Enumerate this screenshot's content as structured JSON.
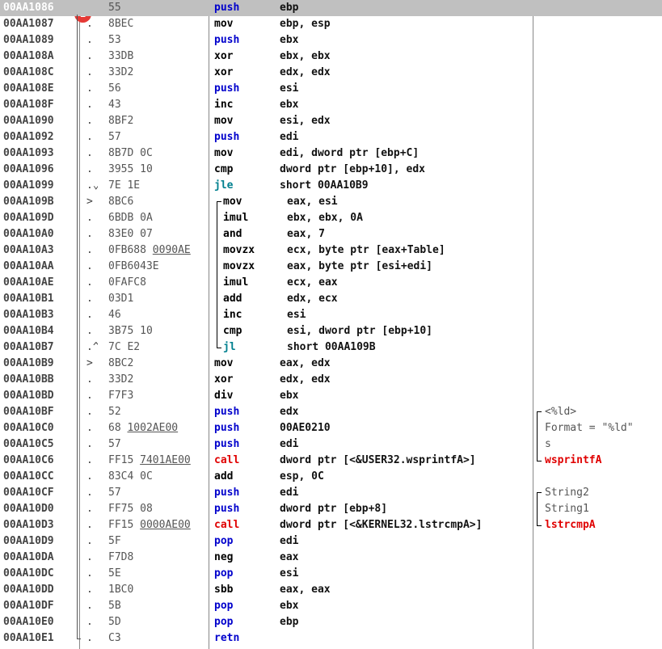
{
  "badge": "1",
  "selected_row": 0,
  "rows": [
    {
      "addr": "00AA1086",
      "mark": "",
      "hex": "55",
      "mnem": "push",
      "ops": "ebp",
      "cm": ""
    },
    {
      "addr": "00AA1087",
      "mark": ".",
      "hex": "8BEC",
      "mnem": "mov",
      "ops": "ebp, esp",
      "cm": ""
    },
    {
      "addr": "00AA1089",
      "mark": ".",
      "hex": "53",
      "mnem": "push",
      "ops": "ebx",
      "cm": ""
    },
    {
      "addr": "00AA108A",
      "mark": ".",
      "hex": "33DB",
      "mnem": "xor",
      "ops": "ebx, ebx",
      "cm": ""
    },
    {
      "addr": "00AA108C",
      "mark": ".",
      "hex": "33D2",
      "mnem": "xor",
      "ops": "edx, edx",
      "cm": ""
    },
    {
      "addr": "00AA108E",
      "mark": ".",
      "hex": "56",
      "mnem": "push",
      "ops": "esi",
      "cm": ""
    },
    {
      "addr": "00AA108F",
      "mark": ".",
      "hex": "43",
      "mnem": "inc",
      "ops": "ebx",
      "cm": ""
    },
    {
      "addr": "00AA1090",
      "mark": ".",
      "hex": "8BF2",
      "mnem": "mov",
      "ops": "esi, edx",
      "cm": ""
    },
    {
      "addr": "00AA1092",
      "mark": ".",
      "hex": "57",
      "mnem": "push",
      "ops": "edi",
      "cm": ""
    },
    {
      "addr": "00AA1093",
      "mark": ".",
      "hex": "8B7D 0C",
      "mnem": "mov",
      "ops": "edi, dword ptr [ebp+C]",
      "cm": ""
    },
    {
      "addr": "00AA1096",
      "mark": ".",
      "hex": "3955 10",
      "mnem": "cmp",
      "ops": "dword ptr [ebp+10], edx",
      "cm": ""
    },
    {
      "addr": "00AA1099",
      "mark": ".⌄",
      "hex": "7E 1E",
      "mnem": "jle",
      "ops": "short 00AA10B9",
      "cm": ""
    },
    {
      "addr": "00AA109B",
      "mark": ">",
      "hex": "8BC6",
      "mnem": "mov",
      "ops": "eax, esi",
      "cm": ""
    },
    {
      "addr": "00AA109D",
      "mark": ".",
      "hex": "6BDB 0A",
      "mnem": "imul",
      "ops": "ebx, ebx, 0A",
      "cm": ""
    },
    {
      "addr": "00AA10A0",
      "mark": ".",
      "hex": "83E0 07",
      "mnem": "and",
      "ops": "eax, 7",
      "cm": ""
    },
    {
      "addr": "00AA10A3",
      "mark": ".",
      "hex": "0FB688 0090AE",
      "mnem": "movzx",
      "ops": "ecx, byte ptr [eax+Table]",
      "cm": ""
    },
    {
      "addr": "00AA10AA",
      "mark": ".",
      "hex": "0FB6043E",
      "mnem": "movzx",
      "ops": "eax, byte ptr [esi+edi]",
      "cm": ""
    },
    {
      "addr": "00AA10AE",
      "mark": ".",
      "hex": "0FAFC8",
      "mnem": "imul",
      "ops": "ecx, eax",
      "cm": ""
    },
    {
      "addr": "00AA10B1",
      "mark": ".",
      "hex": "03D1",
      "mnem": "add",
      "ops": "edx, ecx",
      "cm": ""
    },
    {
      "addr": "00AA10B3",
      "mark": ".",
      "hex": "46",
      "mnem": "inc",
      "ops": "esi",
      "cm": ""
    },
    {
      "addr": "00AA10B4",
      "mark": ".",
      "hex": "3B75 10",
      "mnem": "cmp",
      "ops": "esi, dword ptr [ebp+10]",
      "cm": ""
    },
    {
      "addr": "00AA10B7",
      "mark": ".^",
      "hex": "7C E2",
      "mnem": "jl",
      "ops": "short 00AA109B",
      "cm": ""
    },
    {
      "addr": "00AA10B9",
      "mark": ">",
      "hex": "8BC2",
      "mnem": "mov",
      "ops": "eax, edx",
      "cm": ""
    },
    {
      "addr": "00AA10BB",
      "mark": ".",
      "hex": "33D2",
      "mnem": "xor",
      "ops": "edx, edx",
      "cm": ""
    },
    {
      "addr": "00AA10BD",
      "mark": ".",
      "hex": "F7F3",
      "mnem": "div",
      "ops": "ebx",
      "cm": ""
    },
    {
      "addr": "00AA10BF",
      "mark": ".",
      "hex": "52",
      "mnem": "push",
      "ops": "edx",
      "cm": "<%ld>"
    },
    {
      "addr": "00AA10C0",
      "mark": ".",
      "hex": "68 1002AE00",
      "mnem": "push",
      "ops": "00AE0210",
      "cm": "Format = \"%ld\""
    },
    {
      "addr": "00AA10C5",
      "mark": ".",
      "hex": "57",
      "mnem": "push",
      "ops": "edi",
      "cm": "s"
    },
    {
      "addr": "00AA10C6",
      "mark": ".",
      "hex": "FF15 7401AE00",
      "mnem": "call",
      "ops": "dword ptr [<&USER32.wsprintfA>]",
      "cm": "wsprintfA"
    },
    {
      "addr": "00AA10CC",
      "mark": ".",
      "hex": "83C4 0C",
      "mnem": "add",
      "ops": "esp, 0C",
      "cm": ""
    },
    {
      "addr": "00AA10CF",
      "mark": ".",
      "hex": "57",
      "mnem": "push",
      "ops": "edi",
      "cm": "String2"
    },
    {
      "addr": "00AA10D0",
      "mark": ".",
      "hex": "FF75 08",
      "mnem": "push",
      "ops": "dword ptr [ebp+8]",
      "cm": "String1"
    },
    {
      "addr": "00AA10D3",
      "mark": ".",
      "hex": "FF15 0000AE00",
      "mnem": "call",
      "ops": "dword ptr [<&KERNEL32.lstrcmpA>]",
      "cm": "lstrcmpA"
    },
    {
      "addr": "00AA10D9",
      "mark": ".",
      "hex": "5F",
      "mnem": "pop",
      "ops": "edi",
      "cm": ""
    },
    {
      "addr": "00AA10DA",
      "mark": ".",
      "hex": "F7D8",
      "mnem": "neg",
      "ops": "eax",
      "cm": ""
    },
    {
      "addr": "00AA10DC",
      "mark": ".",
      "hex": "5E",
      "mnem": "pop",
      "ops": "esi",
      "cm": ""
    },
    {
      "addr": "00AA10DD",
      "mark": ".",
      "hex": "1BC0",
      "mnem": "sbb",
      "ops": "eax, eax",
      "cm": ""
    },
    {
      "addr": "00AA10DF",
      "mark": ".",
      "hex": "5B",
      "mnem": "pop",
      "ops": "ebx",
      "cm": ""
    },
    {
      "addr": "00AA10E0",
      "mark": ".",
      "hex": "5D",
      "mnem": "pop",
      "ops": "ebp",
      "cm": ""
    },
    {
      "addr": "00AA10E1",
      "mark": ".",
      "hex": "C3",
      "mnem": "retn",
      "ops": "",
      "cm": ""
    }
  ]
}
